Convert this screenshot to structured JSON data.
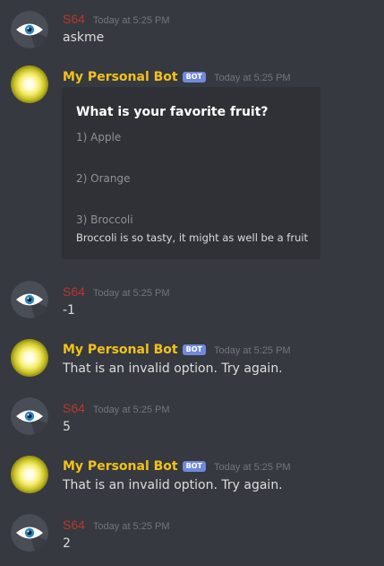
{
  "colors": {
    "background": "#36393f",
    "embed_background": "#2f3136",
    "user_name": "#b8362f",
    "bot_name": "#f2c218",
    "bot_tag": "#7289da",
    "timestamp": "#72767d",
    "message_text": "#dcddde"
  },
  "avatars": {
    "user": "eye-icon",
    "bot": "glowing-orb-icon"
  },
  "messages": [
    {
      "author": "S64",
      "timestamp": "Today at 5:25 PM",
      "text": "askme"
    },
    {
      "author": "My Personal Bot",
      "bot_tag": "BOT",
      "timestamp": "Today at 5:25 PM",
      "embed": {
        "title": "What is your favorite fruit?",
        "options": [
          "1) Apple",
          "2) Orange",
          "3) Broccoli"
        ],
        "description": "Broccoli is so tasty, it might as well be a fruit"
      }
    },
    {
      "author": "S64",
      "timestamp": "Today at 5:25 PM",
      "text": "-1"
    },
    {
      "author": "My Personal Bot",
      "bot_tag": "BOT",
      "timestamp": "Today at 5:25 PM",
      "text": "That is an invalid option. Try again."
    },
    {
      "author": "S64",
      "timestamp": "Today at 5:25 PM",
      "text": "5"
    },
    {
      "author": "My Personal Bot",
      "bot_tag": "BOT",
      "timestamp": "Today at 5:25 PM",
      "text": "That is an invalid option. Try again."
    },
    {
      "author": "S64",
      "timestamp": "Today at 5:25 PM",
      "text": "2"
    }
  ]
}
